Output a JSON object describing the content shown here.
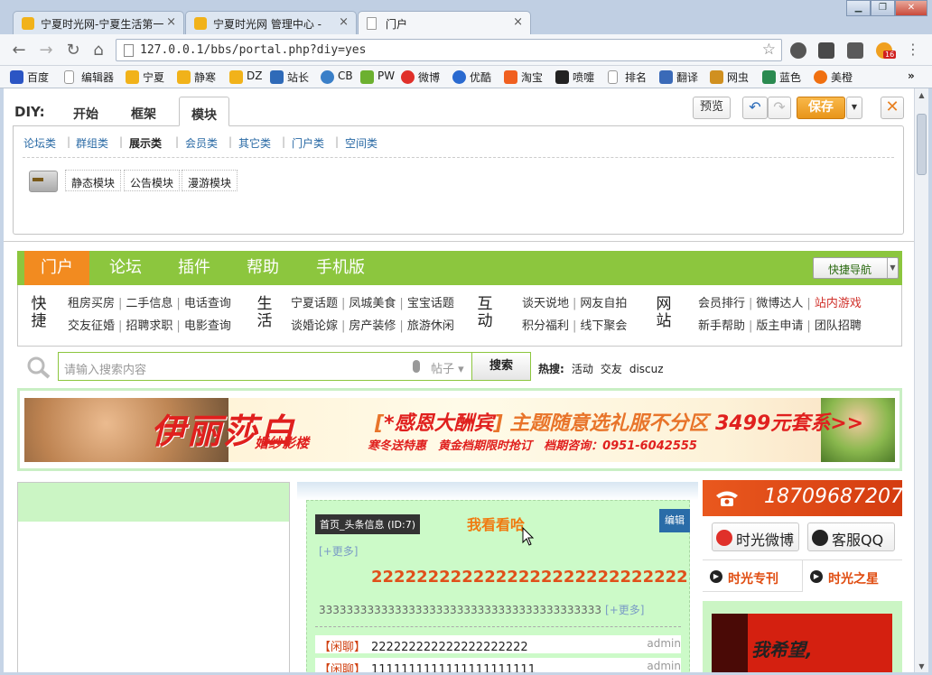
{
  "browser": {
    "tabs": [
      {
        "title": "宁夏时光网-宁夏生活第一",
        "active": false
      },
      {
        "title": "宁夏时光网 管理中心 - ",
        "active": false
      },
      {
        "title": "门户",
        "active": true
      }
    ],
    "address": "127.0.0.1/bbs/portal.php?diy=yes",
    "extension_badge": "16",
    "bookmarks": [
      "百度",
      "编辑器",
      "宁夏",
      "静寒",
      "DZ",
      "站长",
      "CB",
      "PW",
      "微博",
      "优酷",
      "淘宝",
      "喷嚏",
      "排名",
      "翻译",
      "网虫",
      "蓝色",
      "美橙"
    ],
    "bookmarks_more": "»"
  },
  "diy": {
    "label": "DIY:",
    "tabs": [
      "开始",
      "框架",
      "模块"
    ],
    "active_tab": "模块",
    "categories": [
      "论坛类",
      "群组类",
      "展示类",
      "会员类",
      "其它类",
      "门户类",
      "空间类"
    ],
    "active_category": "展示类",
    "modules": [
      "静态模块",
      "公告模块",
      "漫游模块"
    ],
    "preview_label": "预览",
    "undo_icon": "undo-icon",
    "redo_icon": "redo-icon",
    "save_label": "保存",
    "close_label": "✕"
  },
  "portal": {
    "nav": [
      "门户",
      "论坛",
      "插件",
      "帮助",
      "手机版"
    ],
    "active_nav": "门户",
    "quick_nav_label": "快捷导航",
    "link_groups": [
      {
        "label": "快捷",
        "rows": [
          [
            "租房买房",
            "二手信息",
            "电话查询"
          ],
          [
            "交友征婚",
            "招聘求职",
            "电影查询"
          ]
        ]
      },
      {
        "label": "生活",
        "rows": [
          [
            "宁夏话题",
            "凤城美食",
            "宝宝话题"
          ],
          [
            "谈婚论嫁",
            "房产装修",
            "旅游休闲"
          ]
        ]
      },
      {
        "label": "互动",
        "rows": [
          [
            "谈天说地",
            "网友自拍"
          ],
          [
            "积分福利",
            "线下聚会"
          ]
        ]
      },
      {
        "label": "网站",
        "rows": [
          [
            "会员排行",
            "微博达人",
            "站内游戏"
          ],
          [
            "新手帮助",
            "版主申请",
            "团队招聘"
          ]
        ]
      }
    ],
    "search": {
      "placeholder": "请输入搜索内容",
      "type": "帖子",
      "button": "搜索",
      "hot_label": "热搜:",
      "hot_words": [
        "活动",
        "交友",
        "discuz"
      ]
    },
    "banner": {
      "brand": "伊丽莎白",
      "brand_sub": "婚纱影楼",
      "promo_open": "[",
      "promo_em": "*感恩大酬宾",
      "promo_close": "]",
      "promo_main": "主题随意选礼服不分区",
      "promo_price": "3499元套系>>",
      "promo_line2_a": "寒冬送特惠",
      "promo_line2_b": "黄金档期限时抢订",
      "promo_line2_c": "档期咨询：0951-6042555"
    },
    "headline": {
      "block_tag": "首页_头条信息 (ID:7)",
      "edit_label": "编辑",
      "title": "我看看哈",
      "more": "[+更多]",
      "big": "2222222222222222222222222222",
      "sub": "33333333333333333333333333333333333333333",
      "sub_more": "[+更多]",
      "news": [
        {
          "tag": "【闲聊】",
          "title": "222222222222222222222",
          "author": "admin"
        },
        {
          "tag": "【闲聊】",
          "title": "1111111111111111111111",
          "author": "admin"
        }
      ]
    },
    "right": {
      "phone": "18709687207",
      "weibo": "时光微博",
      "qq": "客服QQ",
      "tabs": [
        "时光专刊",
        "时光之星"
      ],
      "promo_text": "我希望,"
    }
  }
}
